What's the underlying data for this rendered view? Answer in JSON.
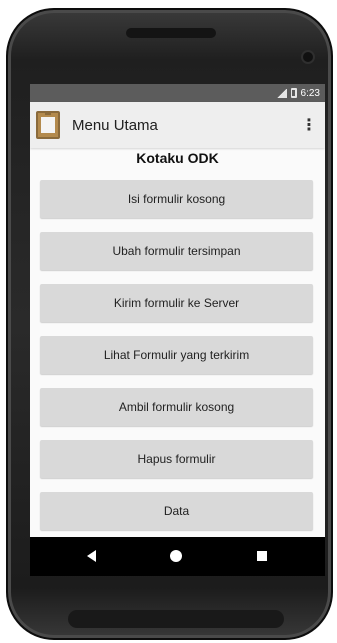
{
  "status_bar": {
    "time": "6:23"
  },
  "app_bar": {
    "title": "Menu Utama",
    "overflow_glyph": "⋮",
    "app_icon": "clipboard-form-icon"
  },
  "heading": "Kotaku ODK",
  "menu": {
    "fill_blank": "Isi formulir kosong",
    "edit_saved": "Ubah formulir tersimpan",
    "send_to_server": "Kirim formulir ke Server",
    "view_sent": "Lihat Formulir yang terkirim",
    "get_blank": "Ambil formulir kosong",
    "delete": "Hapus formulir",
    "data": "Data"
  },
  "nav_bar": {
    "back": "back-icon",
    "home": "home-icon",
    "recent": "recent-apps-icon"
  },
  "colors": {
    "status_bar": "#5c5c5c",
    "app_bar": "#eeeeee",
    "button": "#d9d9d9",
    "nav_bar": "#000000"
  }
}
